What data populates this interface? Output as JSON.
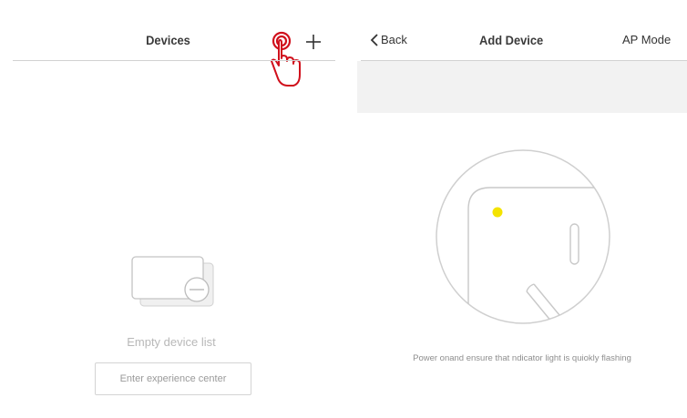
{
  "devices_screen": {
    "title": "Devices",
    "empty_text": "Empty device list",
    "experience_button": "Enter experience center",
    "icons": [
      "plus-icon",
      "tap-hand-icon",
      "empty-device-icon"
    ]
  },
  "add_device_screen": {
    "back_label": "Back",
    "title": "Add Device",
    "ap_mode_label": "AP Mode",
    "instruction": "Power onand ensure that ndicator light is quiokly flashing",
    "icons": [
      "chevron-left-icon",
      "device-indicator-illustration"
    ],
    "indicator_color": "#f4e300"
  },
  "colors": {
    "tap_highlight": "#d0101c",
    "background": "#ffffff",
    "band": "#f2f2f2",
    "divider": "#d2d2d2"
  }
}
